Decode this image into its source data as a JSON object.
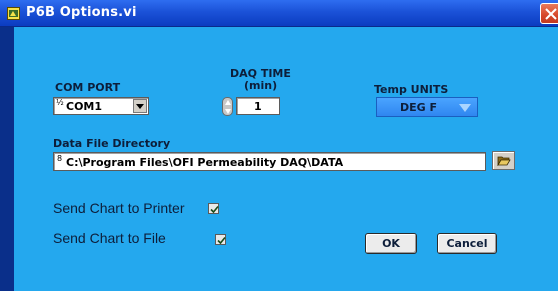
{
  "window": {
    "title": "P6B Options.vi",
    "icons": {
      "app": "labview-vi-icon",
      "close": "close-icon"
    },
    "colors": {
      "frame": "#0a2f8a",
      "panel": "#24a8ee",
      "titlebar": "#1b52d8",
      "close": "#d6472a",
      "accent_button": "#2f86f0"
    }
  },
  "com_port": {
    "label": "COM PORT",
    "radix": "½",
    "value": "COM1"
  },
  "daq_time": {
    "label_line1": "DAQ TIME",
    "label_line2": "(min)",
    "value": "1"
  },
  "temp_units": {
    "label": "Temp UNITS",
    "value": "DEG F"
  },
  "data_file": {
    "label": "Data File Directory",
    "radix": "8",
    "path": "C:\\Program Files\\OFI Permeability DAQ\\DATA",
    "browse_icon": "folder-open-icon"
  },
  "send_printer": {
    "label": "Send Chart to Printer",
    "checked": true
  },
  "send_file": {
    "label": "Send Chart to File",
    "checked": true
  },
  "buttons": {
    "ok": "OK",
    "cancel": "Cancel"
  }
}
